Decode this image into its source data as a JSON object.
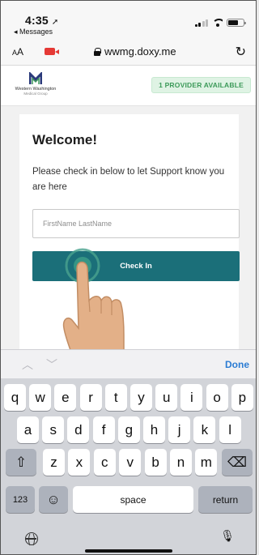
{
  "status_bar": {
    "time": "4:35",
    "location_arrow": "➚",
    "back_label": "◂ Messages"
  },
  "browser": {
    "text_size_label_small": "A",
    "text_size_label_large": "A",
    "url": "wwmg.doxy.me",
    "reload_icon": "↻"
  },
  "site": {
    "logo_name": "Western Washington",
    "logo_sub": "Medical Group",
    "provider_badge": "1 PROVIDER AVAILABLE"
  },
  "checkin_card": {
    "title": "Welcome!",
    "message": "Please check in below to let Support know you are here",
    "name_placeholder": "FirstName LastName",
    "button_label": "Check In",
    "button_color": "#1b6f79"
  },
  "keyboard_accessory": {
    "prev_icon": "︿",
    "next_icon": "﹀",
    "done_label": "Done",
    "done_color": "#2b7cd3"
  },
  "keyboard": {
    "row1": [
      "q",
      "w",
      "e",
      "r",
      "t",
      "y",
      "u",
      "i",
      "o",
      "p"
    ],
    "row2": [
      "a",
      "s",
      "d",
      "f",
      "g",
      "h",
      "j",
      "k",
      "l"
    ],
    "row3": [
      "z",
      "x",
      "c",
      "v",
      "b",
      "n",
      "m"
    ],
    "shift_icon": "⇧",
    "delete_icon": "⌫",
    "numbers_label": "123",
    "emoji_icon": "☺",
    "space_label": "space",
    "return_label": "return",
    "mic_icon": "🎙"
  }
}
